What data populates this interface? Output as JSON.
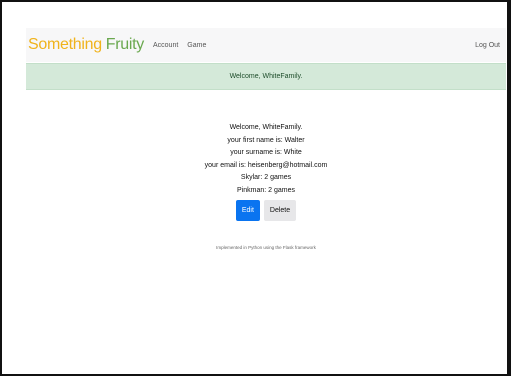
{
  "navbar": {
    "brand_first": "Something",
    "brand_second": "Fruity",
    "links": [
      "Account",
      "Game"
    ],
    "logout": "Log Out"
  },
  "flash": {
    "message": "Welcome, WhiteFamily."
  },
  "profile": {
    "welcome": "Welcome, WhiteFamily.",
    "first_name": "your first name is: Walter",
    "surname": "your surname is: White",
    "email": "your email is: heisenberg@hotmail.com",
    "players": [
      "Skylar: 2 games",
      "Pinkman: 2 games"
    ]
  },
  "buttons": {
    "edit": "Edit",
    "delete": "Delete"
  },
  "footer": {
    "text": "Implemented in Python using the Flask framework"
  },
  "colors": {
    "brand_first": "#f0b31c",
    "brand_second": "#6aa84f",
    "flash_bg": "#d4e9d9",
    "edit_button": "#0a74f0"
  }
}
